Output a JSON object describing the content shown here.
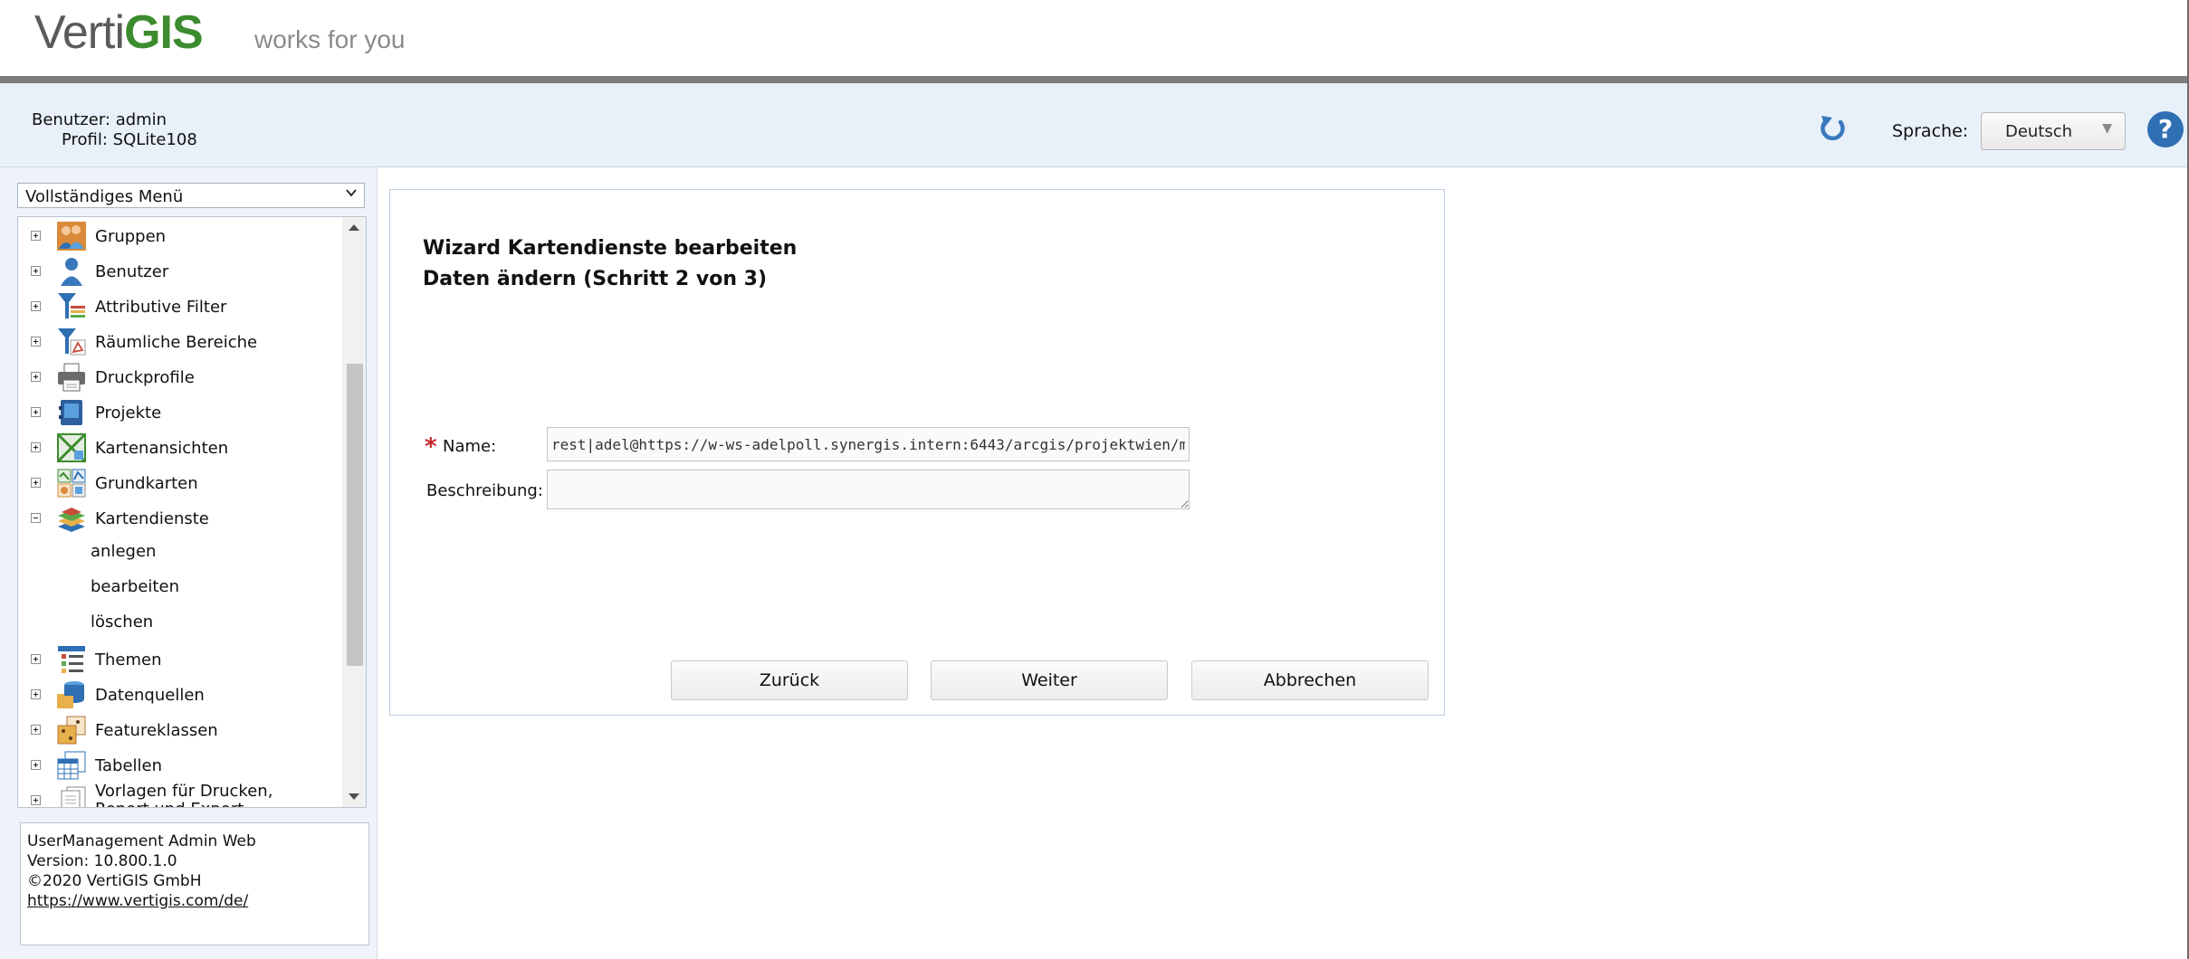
{
  "header": {
    "logo_part1": "Verti",
    "logo_part2": "GIS",
    "tagline": "works for you"
  },
  "userbar": {
    "user_line": "Benutzer: admin",
    "profile_line": "Profil: SQLite108",
    "language_label": "Sprache:",
    "language_value": "Deutsch"
  },
  "sidebar": {
    "menu_select": "Vollständiges Menü",
    "items": [
      {
        "label": "Gruppen",
        "icon": "group-icon"
      },
      {
        "label": "Benutzer",
        "icon": "user-icon"
      },
      {
        "label": "Attributive Filter",
        "icon": "attribute-filter-icon"
      },
      {
        "label": "Räumliche Bereiche",
        "icon": "spatial-filter-icon"
      },
      {
        "label": "Druckprofile",
        "icon": "printer-icon"
      },
      {
        "label": "Projekte",
        "icon": "project-icon"
      },
      {
        "label": "Kartenansichten",
        "icon": "map-view-icon"
      },
      {
        "label": "Grundkarten",
        "icon": "basemap-icon"
      },
      {
        "label": "Kartendienste",
        "icon": "map-service-icon"
      },
      {
        "label": "Themen",
        "icon": "theme-icon"
      },
      {
        "label": "Datenquellen",
        "icon": "datasource-icon"
      },
      {
        "label": "Featureklassen",
        "icon": "feature-class-icon"
      },
      {
        "label": "Tabellen",
        "icon": "table-icon"
      },
      {
        "label": "Vorlagen für Drucken,",
        "label2": "Report und Export",
        "icon": "template-icon"
      }
    ],
    "subitems": [
      "anlegen",
      "bearbeiten",
      "löschen"
    ],
    "info": {
      "app_name": "UserManagement Admin Web",
      "version": "Version: 10.800.1.0",
      "copyright": "©2020 VertiGIS GmbH",
      "link": "https://www.vertigis.com/de/"
    }
  },
  "wizard": {
    "title": "Wizard Kartendienste bearbeiten",
    "subtitle": "Daten ändern (Schritt 2 von 3)",
    "name_label": "Name:",
    "name_value": "rest|adel@https://w-ws-adelpoll.synergis.intern:6443/arcgis/projektwien/museum",
    "description_label": "Beschreibung:",
    "description_value": "",
    "buttons": {
      "back": "Zurück",
      "next": "Weiter",
      "cancel": "Abbrechen"
    }
  },
  "colors": {
    "brand_green": "#3d8b2f",
    "infobar_bg": "#e8f0f9",
    "help_blue": "#2f6fb3",
    "required_red": "#c62828"
  }
}
